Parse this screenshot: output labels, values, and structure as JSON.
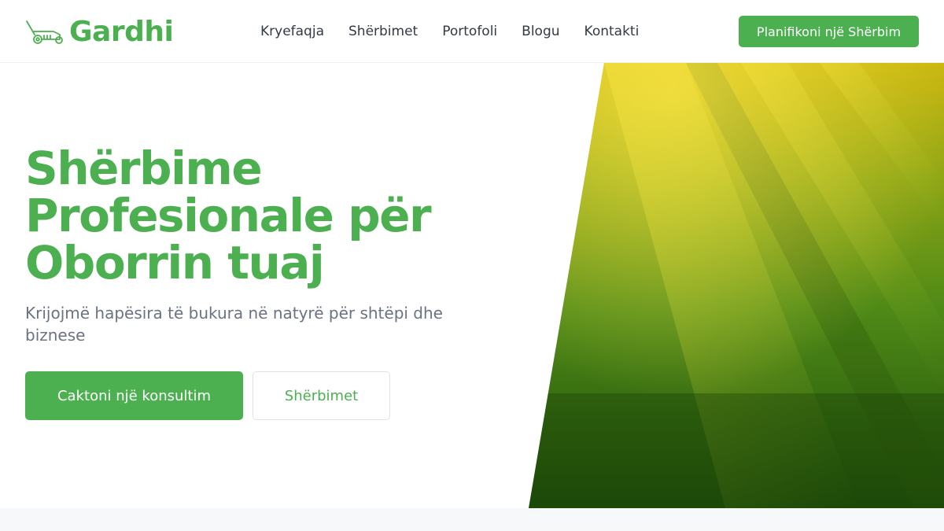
{
  "brand": {
    "name": "Gardhi",
    "logo_icon": "lawnmower-icon",
    "accent_color": "#4caf50"
  },
  "nav": {
    "items": [
      {
        "label": "Kryefaqja"
      },
      {
        "label": "Shërbimet"
      },
      {
        "label": "Portofoli"
      },
      {
        "label": "Blogu"
      },
      {
        "label": "Kontakti"
      }
    ],
    "cta_label": "Planifikoni një Shërbim"
  },
  "hero": {
    "title": "Shërbime Profesionale për Oborrin tuaj",
    "subtitle": "Krijojmë hapësira të bukura në natyrë për shtëpi dhe biznese",
    "primary_button": "Caktoni një konsultim",
    "secondary_button": "Shërbimet",
    "image_subject": "sunlit-lawn-grass-image"
  }
}
